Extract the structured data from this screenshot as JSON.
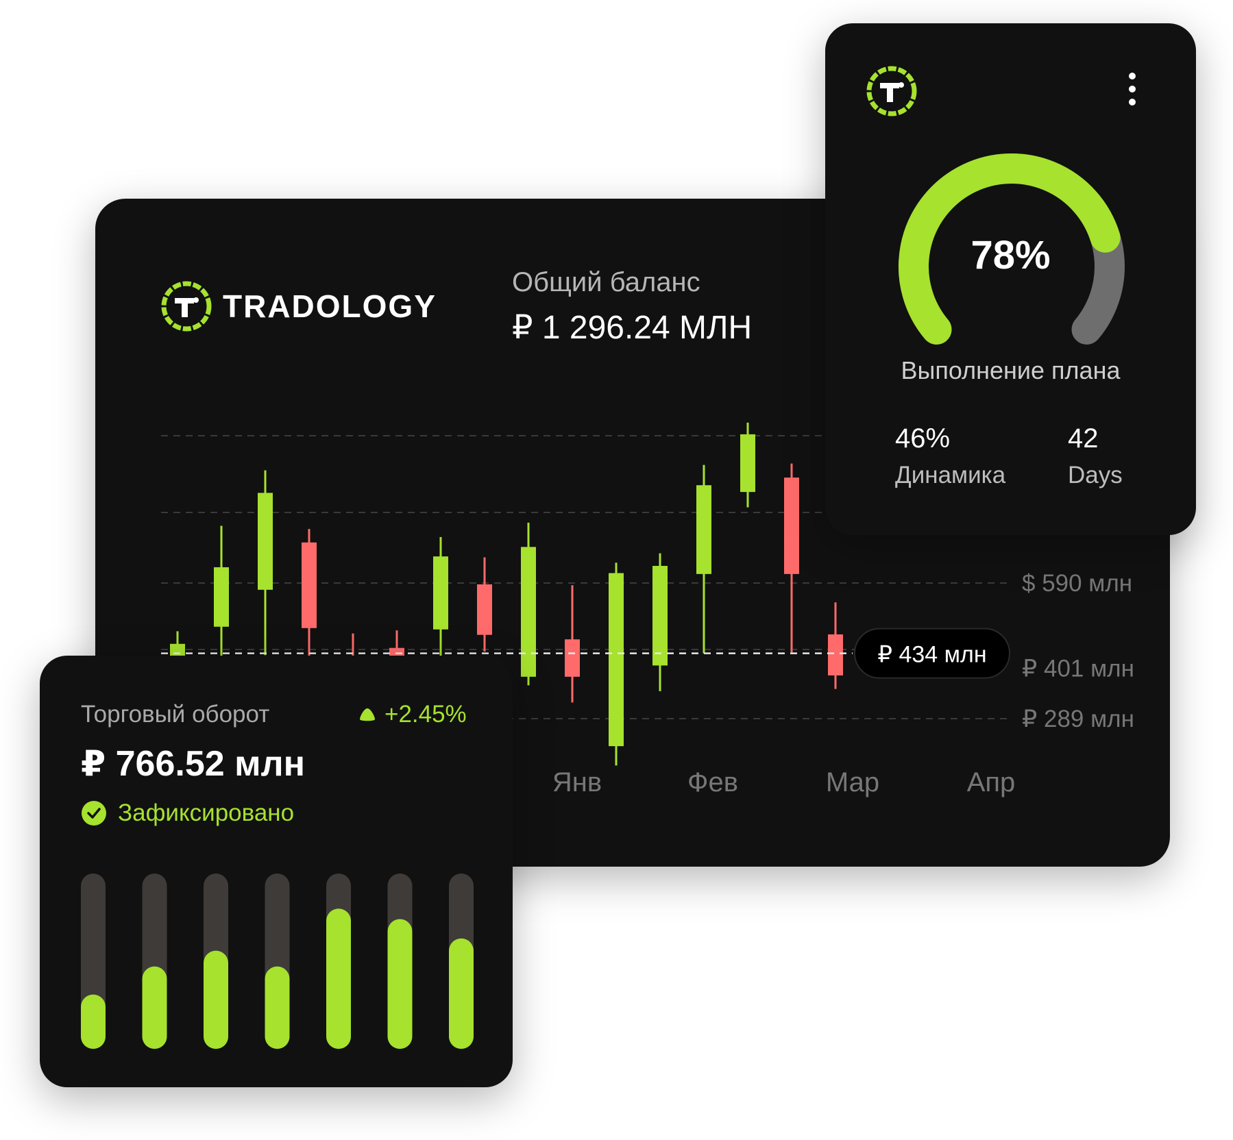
{
  "brand": {
    "name": "TRADOLOGY",
    "accent": "#a6e22e"
  },
  "balance": {
    "label": "Общий баланс",
    "value": "₽ 1 296.24 МЛН"
  },
  "plan": {
    "percent_text": "78%",
    "percent": 78,
    "caption": "Выполнение плана",
    "stats": [
      {
        "value": "46%",
        "label": "Динамика"
      },
      {
        "value": "42",
        "label": "Days"
      }
    ]
  },
  "turnover": {
    "label": "Торговый оборот",
    "change": "+2.45%",
    "value": "₽ 766.52 млн",
    "status": "Зафиксировано"
  },
  "chart_data": [
    {
      "type": "candlestick",
      "y_ticks": [
        "$ 590 млн",
        "₽ 401 млн",
        "₽ 289 млн"
      ],
      "y_tick_values": [
        590,
        401,
        289
      ],
      "x_ticks": [
        "Янв",
        "Фев",
        "Мар",
        "Апр"
      ],
      "current_price_label": "₽ 434 млн",
      "current_price": 434,
      "grid": true,
      "colors": {
        "up": "#a6e22e",
        "down": "#ff6b6b"
      },
      "candles": [
        {
          "open": 380,
          "close": 455,
          "high": 483,
          "low": 360,
          "dir": "up"
        },
        {
          "open": 493,
          "close": 625,
          "high": 717,
          "low": 425,
          "dir": "up"
        },
        {
          "open": 575,
          "close": 790,
          "high": 840,
          "low": 430,
          "dir": "up"
        },
        {
          "open": 680,
          "close": 490,
          "high": 710,
          "low": 395,
          "dir": "down"
        },
        {
          "open": 396,
          "close": 350,
          "high": 478,
          "low": 300,
          "dir": "down"
        },
        {
          "open": 446,
          "close": 390,
          "high": 485,
          "low": 380,
          "dir": "down"
        },
        {
          "open": 487,
          "close": 649,
          "high": 692,
          "low": 395,
          "dir": "up"
        },
        {
          "open": 587,
          "close": 475,
          "high": 647,
          "low": 438,
          "dir": "down"
        },
        {
          "open": 382,
          "close": 670,
          "high": 724,
          "low": 363,
          "dir": "up"
        },
        {
          "open": 465,
          "close": 382,
          "high": 585,
          "low": 325,
          "dir": "down"
        },
        {
          "open": 228,
          "close": 612,
          "high": 635,
          "low": 185,
          "dir": "up"
        },
        {
          "open": 407,
          "close": 628,
          "high": 656,
          "low": 350,
          "dir": "up"
        },
        {
          "open": 610,
          "close": 807,
          "high": 852,
          "low": 434,
          "dir": "up"
        },
        {
          "open": 792,
          "close": 920,
          "high": 946,
          "low": 758,
          "dir": "up"
        },
        {
          "open": 824,
          "close": 610,
          "high": 855,
          "low": 436,
          "dir": "down"
        },
        {
          "open": 476,
          "close": 385,
          "high": 547,
          "low": 355,
          "dir": "down"
        }
      ]
    },
    {
      "type": "bar",
      "values": [
        0.31,
        0.47,
        0.56,
        0.47,
        0.8,
        0.74,
        0.63
      ]
    }
  ]
}
